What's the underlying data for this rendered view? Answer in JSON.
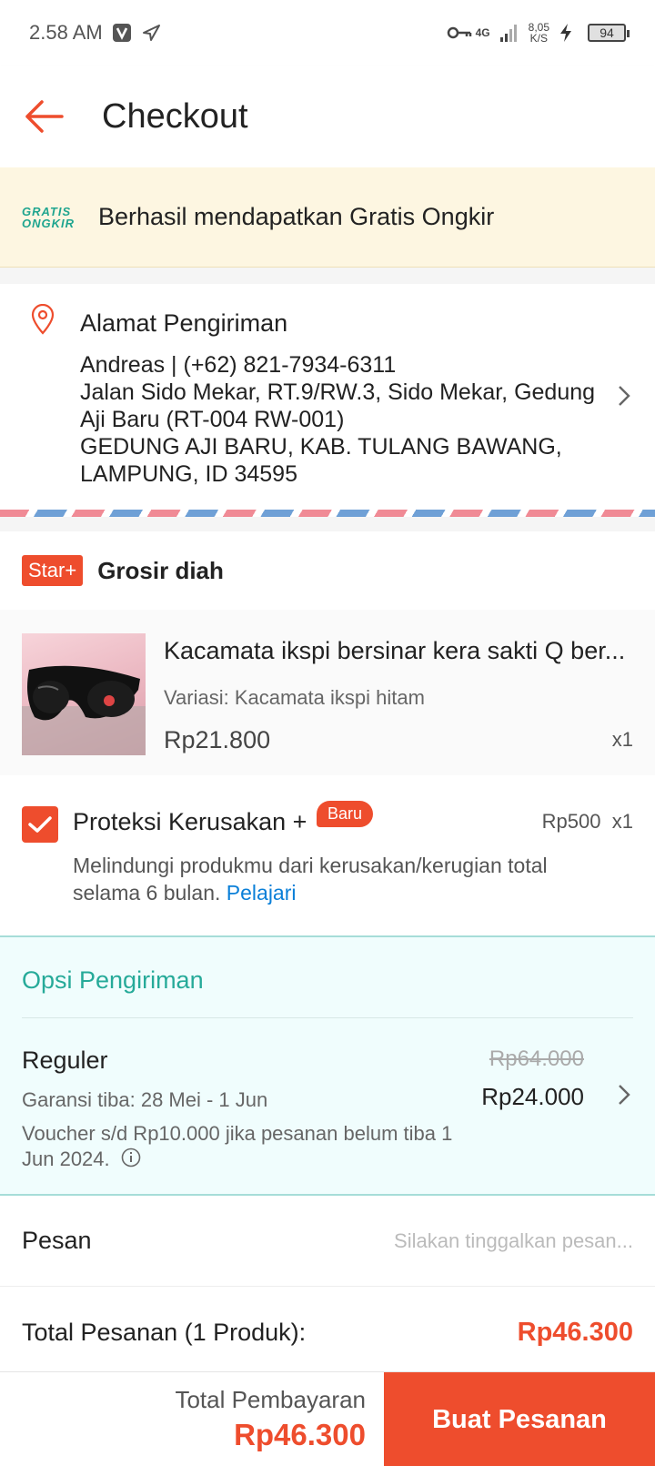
{
  "status_bar": {
    "time": "2.58 AM",
    "network": "4G",
    "speed_value": "8,05",
    "speed_unit": "K/S",
    "battery": "94"
  },
  "header": {
    "title": "Checkout"
  },
  "free_shipping": {
    "logo_line1": "GRATIS",
    "logo_line2": "ONGKIR",
    "text": "Berhasil mendapatkan Gratis Ongkir"
  },
  "address": {
    "title": "Alamat Pengiriman",
    "contact": "Andreas | (+62) 821-7934-6311",
    "line1": "Jalan Sido Mekar, RT.9/RW.3, Sido Mekar, Gedung Aji Baru (RT-004 RW-001)",
    "line2": "GEDUNG AJI BARU, KAB. TULANG BAWANG, LAMPUNG, ID 34595"
  },
  "shop": {
    "badge": "Star+",
    "name": "Grosir diah"
  },
  "product": {
    "name": "Kacamata ikspi bersinar kera sakti Q ber...",
    "variant": "Variasi: Kacamata ikspi hitam",
    "price": "Rp21.800",
    "qty": "x1"
  },
  "protection": {
    "title": "Proteksi Kerusakan +",
    "badge": "Baru",
    "price": "Rp500",
    "qty": "x1",
    "desc": "Melindungi produkmu dari kerusakan/kerugian total selama 6 bulan.",
    "link": "Pelajari",
    "checked": true
  },
  "shipping": {
    "heading": "Opsi Pengiriman",
    "name": "Reguler",
    "guarantee": "Garansi tiba: 28 Mei - 1 Jun",
    "voucher": "Voucher s/d  Rp10.000 jika pesanan belum tiba 1 Jun 2024.",
    "old_price": "Rp64.000",
    "price": "Rp24.000"
  },
  "message": {
    "label": "Pesan",
    "placeholder": "Silakan tinggalkan pesan..."
  },
  "order_total": {
    "label": "Total Pesanan (1 Produk):",
    "value": "Rp46.300"
  },
  "bottom_bar": {
    "label": "Total Pembayaran",
    "amount": "Rp46.300",
    "button": "Buat Pesanan"
  },
  "colors": {
    "accent": "#ee4d2d",
    "teal": "#26aa99",
    "link": "#0a7fd8",
    "banner_bg": "#fdf6e1"
  }
}
